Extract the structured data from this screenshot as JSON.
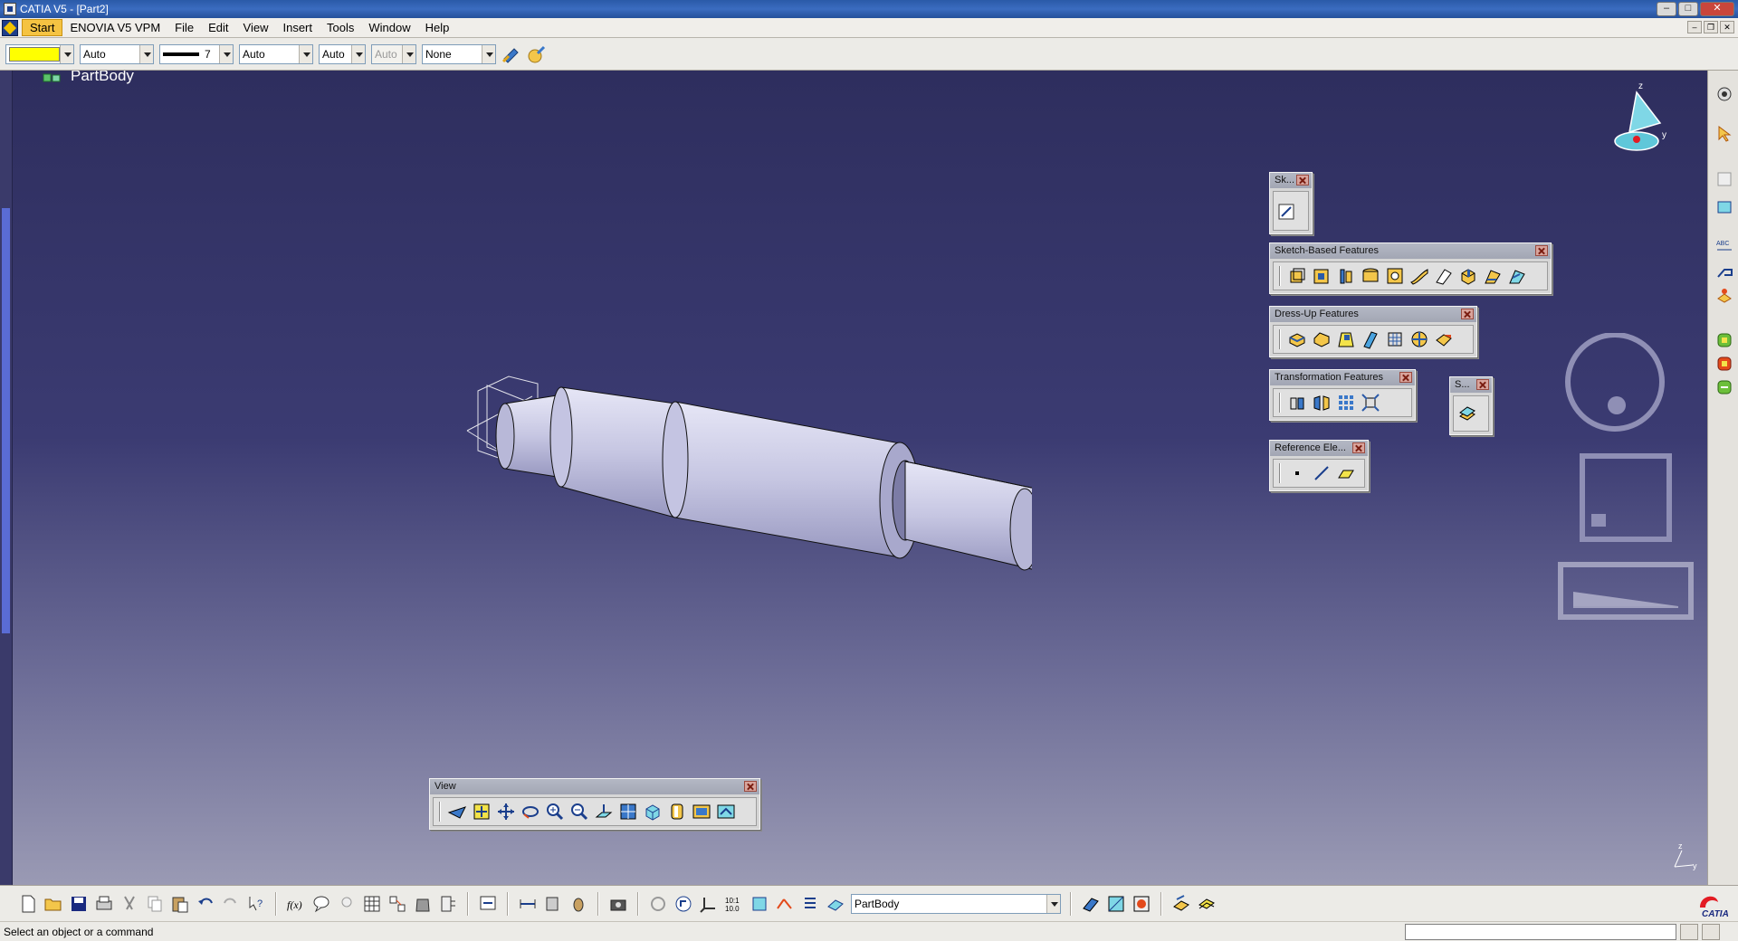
{
  "window": {
    "title": "CATIA V5 - [Part2]",
    "controls": [
      "–",
      "□",
      "✕"
    ]
  },
  "menubar": {
    "items": [
      {
        "label": "Start",
        "key": "S"
      },
      {
        "label": "ENOVIA V5 VPM",
        "key": "E"
      },
      {
        "label": "File",
        "key": "F"
      },
      {
        "label": "Edit",
        "key": "E"
      },
      {
        "label": "View",
        "key": "V"
      },
      {
        "label": "Insert",
        "key": "I"
      },
      {
        "label": "Tools",
        "key": "T"
      },
      {
        "label": "Window",
        "key": "W"
      },
      {
        "label": "Help",
        "key": "H"
      }
    ],
    "mdi_controls": [
      "–",
      "❐",
      "✕"
    ]
  },
  "propbar": {
    "color_value": "#ffff00",
    "transparency": "Auto",
    "line_thickness": "7",
    "line_type": "Auto",
    "point_symbol": "Auto",
    "layer_disabled": "Auto",
    "render_style": "None"
  },
  "tree": {
    "root_label": "PartBody"
  },
  "toolbars": {
    "sketcher": {
      "title": "Sk..."
    },
    "sketch_based": {
      "title": "Sketch-Based Features",
      "icons": [
        "pad-icon",
        "pocket-icon",
        "shaft-icon",
        "groove-icon",
        "hole-icon",
        "rib-icon",
        "slot-icon",
        "stiffener-icon",
        "loft-icon",
        "remove-loft-icon"
      ]
    },
    "dress_up": {
      "title": "Dress-Up Features",
      "icons": [
        "edge-fillet-icon",
        "chamfer-icon",
        "draft-icon",
        "shell-icon",
        "thickness-icon",
        "thread-icon",
        "remove-face-icon"
      ]
    },
    "transformation": {
      "title": "Transformation Features",
      "icons": [
        "translation-icon",
        "mirror-icon",
        "rectangular-pattern-icon",
        "scaling-icon"
      ]
    },
    "surface_based": {
      "title": "S..."
    },
    "reference": {
      "title": "Reference Ele...",
      "icons": [
        "point-icon",
        "line-icon",
        "plane-icon"
      ]
    },
    "view": {
      "title": "View",
      "icons": [
        "fly-mode-icon",
        "fit-all-icon",
        "pan-icon",
        "rotate-icon",
        "zoom-in-icon",
        "zoom-out-icon",
        "normal-view-icon",
        "multi-view-icon",
        "iso-view-icon",
        "shading-icon",
        "hide-show-icon",
        "swap-space-icon"
      ]
    }
  },
  "bottom_toolbar": {
    "work_object": "PartBody"
  },
  "status": {
    "message": "Select an object or a command"
  },
  "colors": {
    "viewport_top": "#2e2e5e",
    "viewport_bottom": "#9a9ab4",
    "part_fill": "#c8c8e8",
    "accent": "#f5c342"
  },
  "branding": {
    "logo_text": "CATIA"
  }
}
